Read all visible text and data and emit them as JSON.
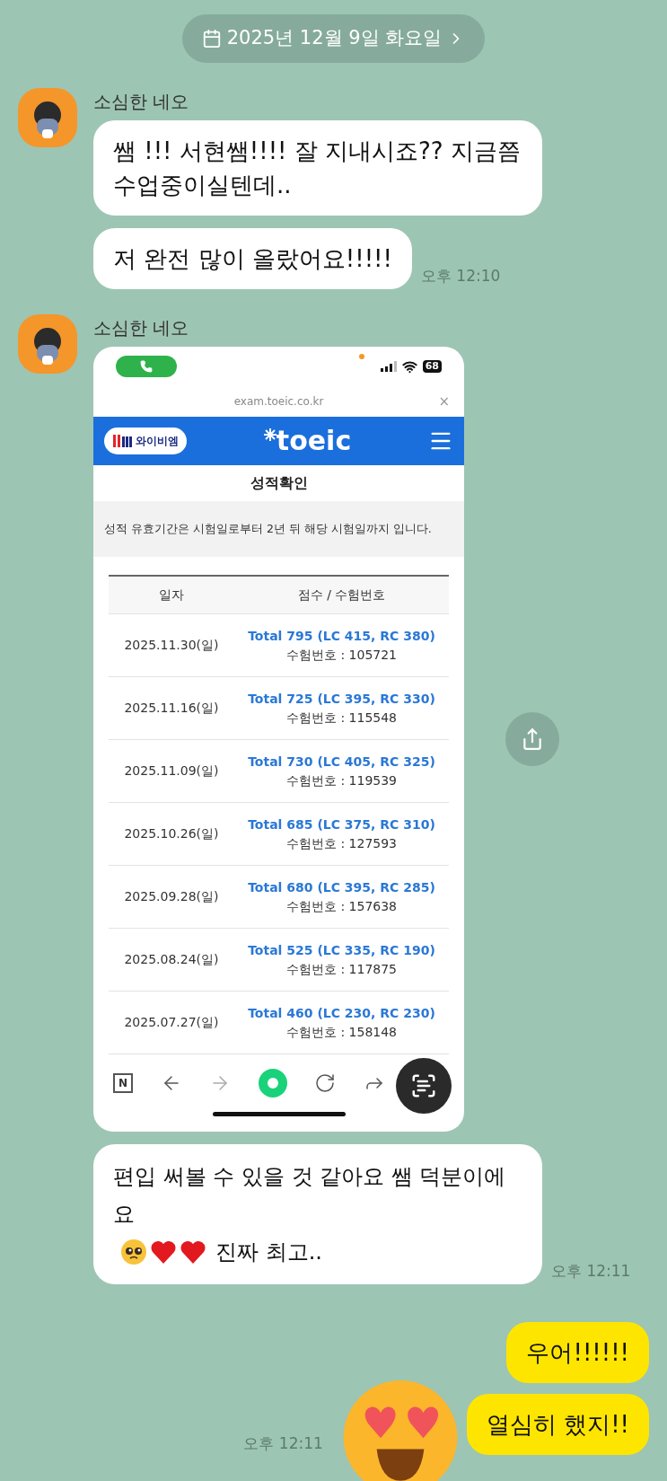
{
  "date_divider": {
    "label": "2025년 12월 9일 화요일"
  },
  "chat": [
    {
      "kind": "incoming",
      "sender": "소심한 네오",
      "time": "오후 12:10",
      "items": [
        {
          "kind": "text",
          "text": "쌤 !!! 서현쌤!!!! 잘 지내시죠?? 지금쯤 수업중이실텐데.."
        },
        {
          "kind": "text",
          "text": "저 완전 많이 올랐어요!!!!!"
        }
      ]
    },
    {
      "kind": "incoming",
      "sender": "소심한 네오",
      "time": "오후 12:11",
      "items": [
        {
          "kind": "screenshot"
        },
        {
          "kind": "text_with_emoji",
          "text_before": "편입 써볼 수 있을 것 같아요 쌤 덕분이에요",
          "text_after": "진짜 최고.."
        }
      ]
    },
    {
      "kind": "outgoing",
      "time": "오후 12:11",
      "items": [
        {
          "kind": "text",
          "text": "우어!!!!!!"
        },
        {
          "kind": "text",
          "text": "열심히 했지!!"
        }
      ]
    }
  ],
  "screenshot": {
    "battery": "68",
    "url": "exam.toeic.co.kr",
    "close": "×",
    "brand_badge": "와이비엠",
    "logo": "toeic",
    "page_title": "성적확인",
    "notice": "성적 유효기간은 시험일로부터 2년 뒤 해당 시험일까지 입니다.",
    "columns": [
      "일자",
      "점수 / 수험번호"
    ],
    "rows": [
      {
        "date": "2025.11.30(일)",
        "score": "Total 795 (LC 415, RC 380)",
        "exam_no": "수험번호 : 105721"
      },
      {
        "date": "2025.11.16(일)",
        "score": "Total 725 (LC 395, RC 330)",
        "exam_no": "수험번호 : 115548"
      },
      {
        "date": "2025.11.09(일)",
        "score": "Total 730 (LC 405, RC 325)",
        "exam_no": "수험번호 : 119539"
      },
      {
        "date": "2025.10.26(일)",
        "score": "Total 685 (LC 375, RC 310)",
        "exam_no": "수험번호 : 127593"
      },
      {
        "date": "2025.09.28(일)",
        "score": "Total 680 (LC 395, RC 285)",
        "exam_no": "수험번호 : 157638"
      },
      {
        "date": "2025.08.24(일)",
        "score": "Total 525 (LC 335, RC 190)",
        "exam_no": "수험번호 : 117875"
      },
      {
        "date": "2025.07.27(일)",
        "score": "Total 460 (LC 230, RC 230)",
        "exam_no": "수험번호 : 158148"
      }
    ],
    "toolbar_n": "N"
  }
}
